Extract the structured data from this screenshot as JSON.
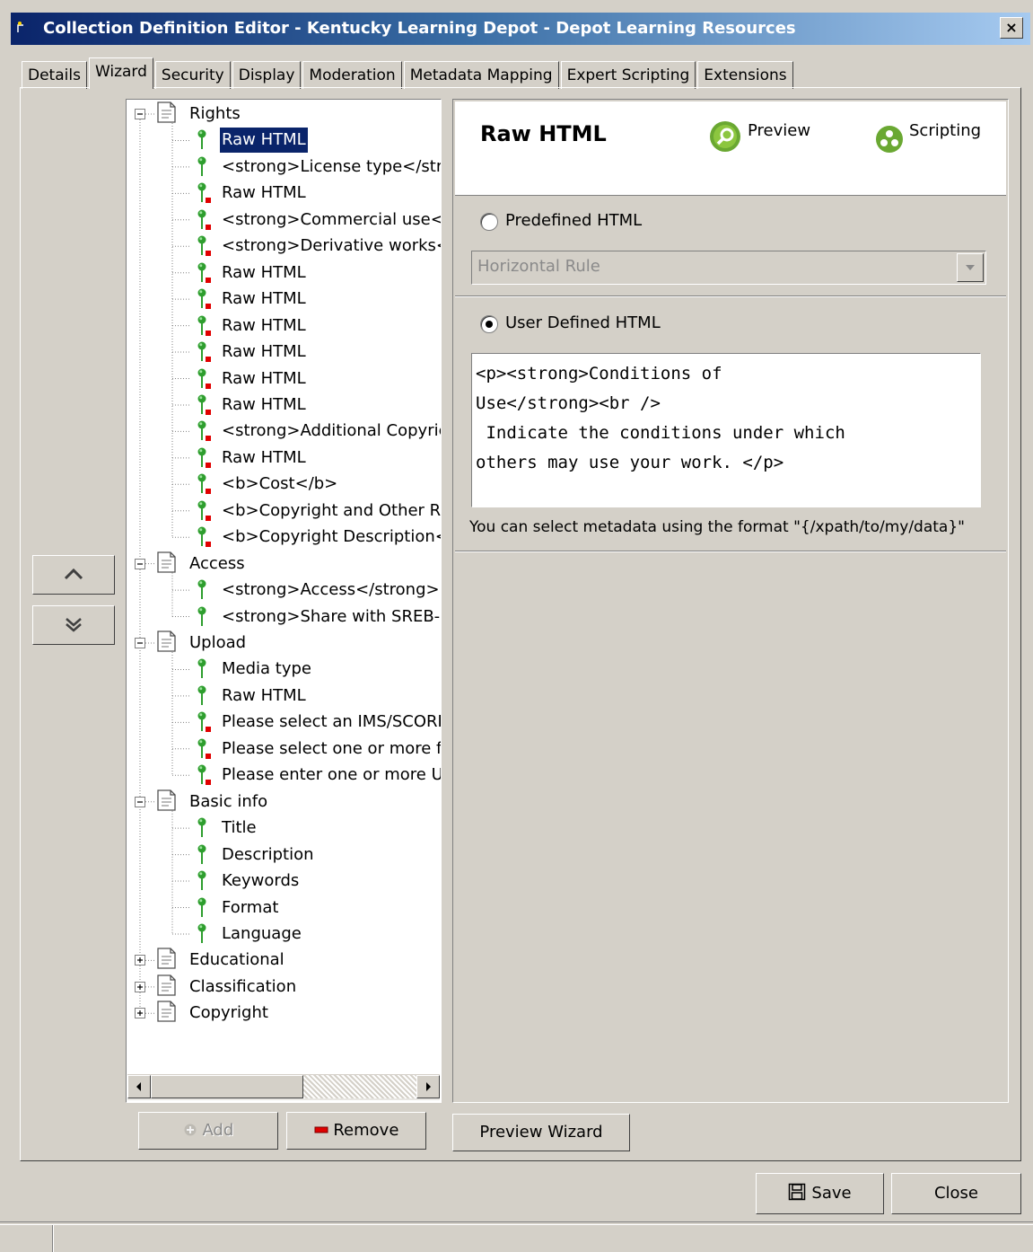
{
  "window": {
    "title": "Collection Definition Editor - Kentucky Learning Depot - Depot Learning Resources",
    "close_label": "×"
  },
  "tabs": [
    "Details",
    "Wizard",
    "Security",
    "Display",
    "Moderation",
    "Metadata Mapping",
    "Expert Scripting",
    "Extensions"
  ],
  "active_tab": "Wizard",
  "tree": {
    "groups": [
      {
        "label": "Rights",
        "expanded": true,
        "items": [
          {
            "label": "Raw HTML",
            "selected": true,
            "flag": false
          },
          {
            "label": "<strong>License type</str",
            "flag": false
          },
          {
            "label": "Raw HTML",
            "flag": true
          },
          {
            "label": "<strong>Commercial use</",
            "flag": true
          },
          {
            "label": "<strong>Derivative works<",
            "flag": true
          },
          {
            "label": "Raw HTML",
            "flag": true
          },
          {
            "label": "Raw HTML",
            "flag": true
          },
          {
            "label": "Raw HTML",
            "flag": true
          },
          {
            "label": "Raw HTML",
            "flag": true
          },
          {
            "label": "Raw HTML",
            "flag": true
          },
          {
            "label": "Raw HTML",
            "flag": true
          },
          {
            "label": "<strong>Additional Copyric",
            "flag": true
          },
          {
            "label": "Raw HTML",
            "flag": true
          },
          {
            "label": "<b>Cost</b>",
            "flag": true
          },
          {
            "label": "<b>Copyright and Other R",
            "flag": true
          },
          {
            "label": "<b>Copyright Description<",
            "flag": true
          }
        ]
      },
      {
        "label": "Access",
        "expanded": true,
        "items": [
          {
            "label": "<strong>Access</strong>",
            "flag": false
          },
          {
            "label": "<strong>Share with SREB-:",
            "flag": false
          }
        ]
      },
      {
        "label": "Upload",
        "expanded": true,
        "items": [
          {
            "label": "Media type",
            "flag": false
          },
          {
            "label": "Raw HTML",
            "flag": false
          },
          {
            "label": "Please select an IMS/SCORI",
            "flag": true
          },
          {
            "label": "Please select one or more fi",
            "flag": true
          },
          {
            "label": "Please enter one or more U",
            "flag": true
          }
        ]
      },
      {
        "label": "Basic info",
        "expanded": true,
        "items": [
          {
            "label": "Title",
            "flag": false
          },
          {
            "label": "Description",
            "flag": false
          },
          {
            "label": "Keywords",
            "flag": false
          },
          {
            "label": "Format",
            "flag": false
          },
          {
            "label": "Language",
            "flag": false
          }
        ]
      },
      {
        "label": "Educational",
        "expanded": false,
        "items": []
      },
      {
        "label": "Classification",
        "expanded": false,
        "items": []
      },
      {
        "label": "Copyright",
        "expanded": false,
        "items": []
      }
    ]
  },
  "buttons": {
    "add": "Add",
    "remove": "Remove",
    "preview_wizard": "Preview Wizard",
    "save": "Save",
    "close": "Close"
  },
  "editor": {
    "title": "Raw HTML",
    "preview_link": "Preview",
    "scripting_link": "Scripting",
    "predefined_label": "Predefined HTML",
    "predefined_selected": false,
    "predefined_value": "Horizontal Rule",
    "user_defined_label": "User Defined HTML",
    "user_defined_selected": true,
    "html_content": "<p><strong>Conditions of\nUse</strong><br />\n Indicate the conditions under which\nothers may use your work. </p>",
    "hint": "You can select metadata using the format \"{/xpath/to/my/data}\""
  },
  "colors": {
    "window_bg": "#d4d0c8",
    "title_gradient_start": "#0a246a",
    "title_gradient_end": "#a6caf0",
    "selection": "#0a246a",
    "flag_red": "#e00000",
    "pin_green": "#2e9e2e"
  }
}
